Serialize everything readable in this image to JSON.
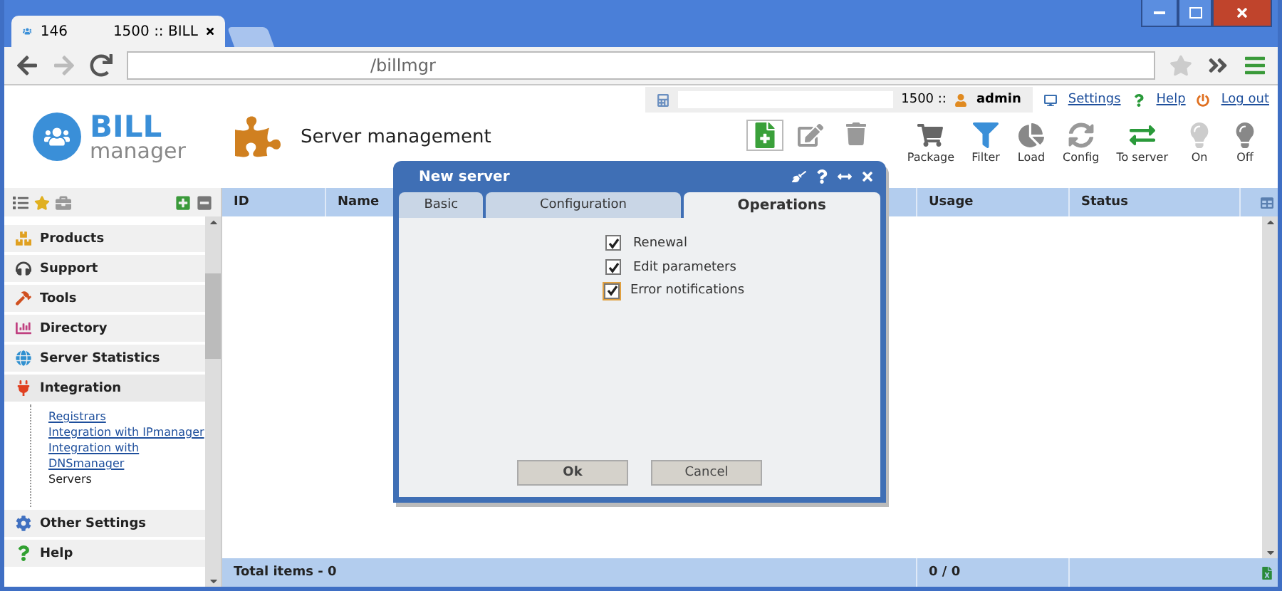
{
  "browser": {
    "tab": {
      "title": "146",
      "subtitle": "1500 :: BILL",
      "selected": true
    },
    "address": "/billmgr"
  },
  "header": {
    "logo": {
      "word": "BILL",
      "sub": "manager"
    },
    "title": "Server management",
    "account": "1500 ::",
    "user": "admin",
    "links": [
      "Settings",
      "Help",
      "Log out"
    ]
  },
  "toolbar": [
    {
      "label": "Package"
    },
    {
      "label": "Filter"
    },
    {
      "label": "Load"
    },
    {
      "label": "Config"
    },
    {
      "label": "To server"
    },
    {
      "label": "On"
    },
    {
      "label": "Off"
    }
  ],
  "sidebar": {
    "sections": [
      {
        "label": "Products"
      },
      {
        "label": "Support"
      },
      {
        "label": "Tools"
      },
      {
        "label": "Directory"
      },
      {
        "label": "Server Statistics"
      },
      {
        "label": "Integration",
        "children": [
          {
            "label": "Registrars",
            "selected": false
          },
          {
            "label": "Integration with IPmanager",
            "selected": false
          },
          {
            "label": "Integration with DNSmanager",
            "selected": false
          },
          {
            "label": "Servers",
            "selected": true
          }
        ]
      },
      {
        "label": "Other Settings"
      },
      {
        "label": "Help"
      }
    ]
  },
  "table": {
    "columns": [
      "ID",
      "Name",
      "Usage",
      "Status"
    ],
    "footer": {
      "total": "Total items - 0",
      "usage": "0 / 0"
    }
  },
  "dialog": {
    "title": "New server",
    "tabs": [
      {
        "label": "Basic",
        "selected": false
      },
      {
        "label": "Configuration",
        "selected": false
      },
      {
        "label": "Operations",
        "selected": true
      }
    ],
    "options": [
      {
        "label": "Renewal",
        "checked": true,
        "focused": false
      },
      {
        "label": "Edit parameters",
        "checked": true,
        "focused": false
      },
      {
        "label": "Error notifications",
        "checked": true,
        "focused": true
      }
    ],
    "buttons": [
      "Ok",
      "Cancel"
    ]
  }
}
